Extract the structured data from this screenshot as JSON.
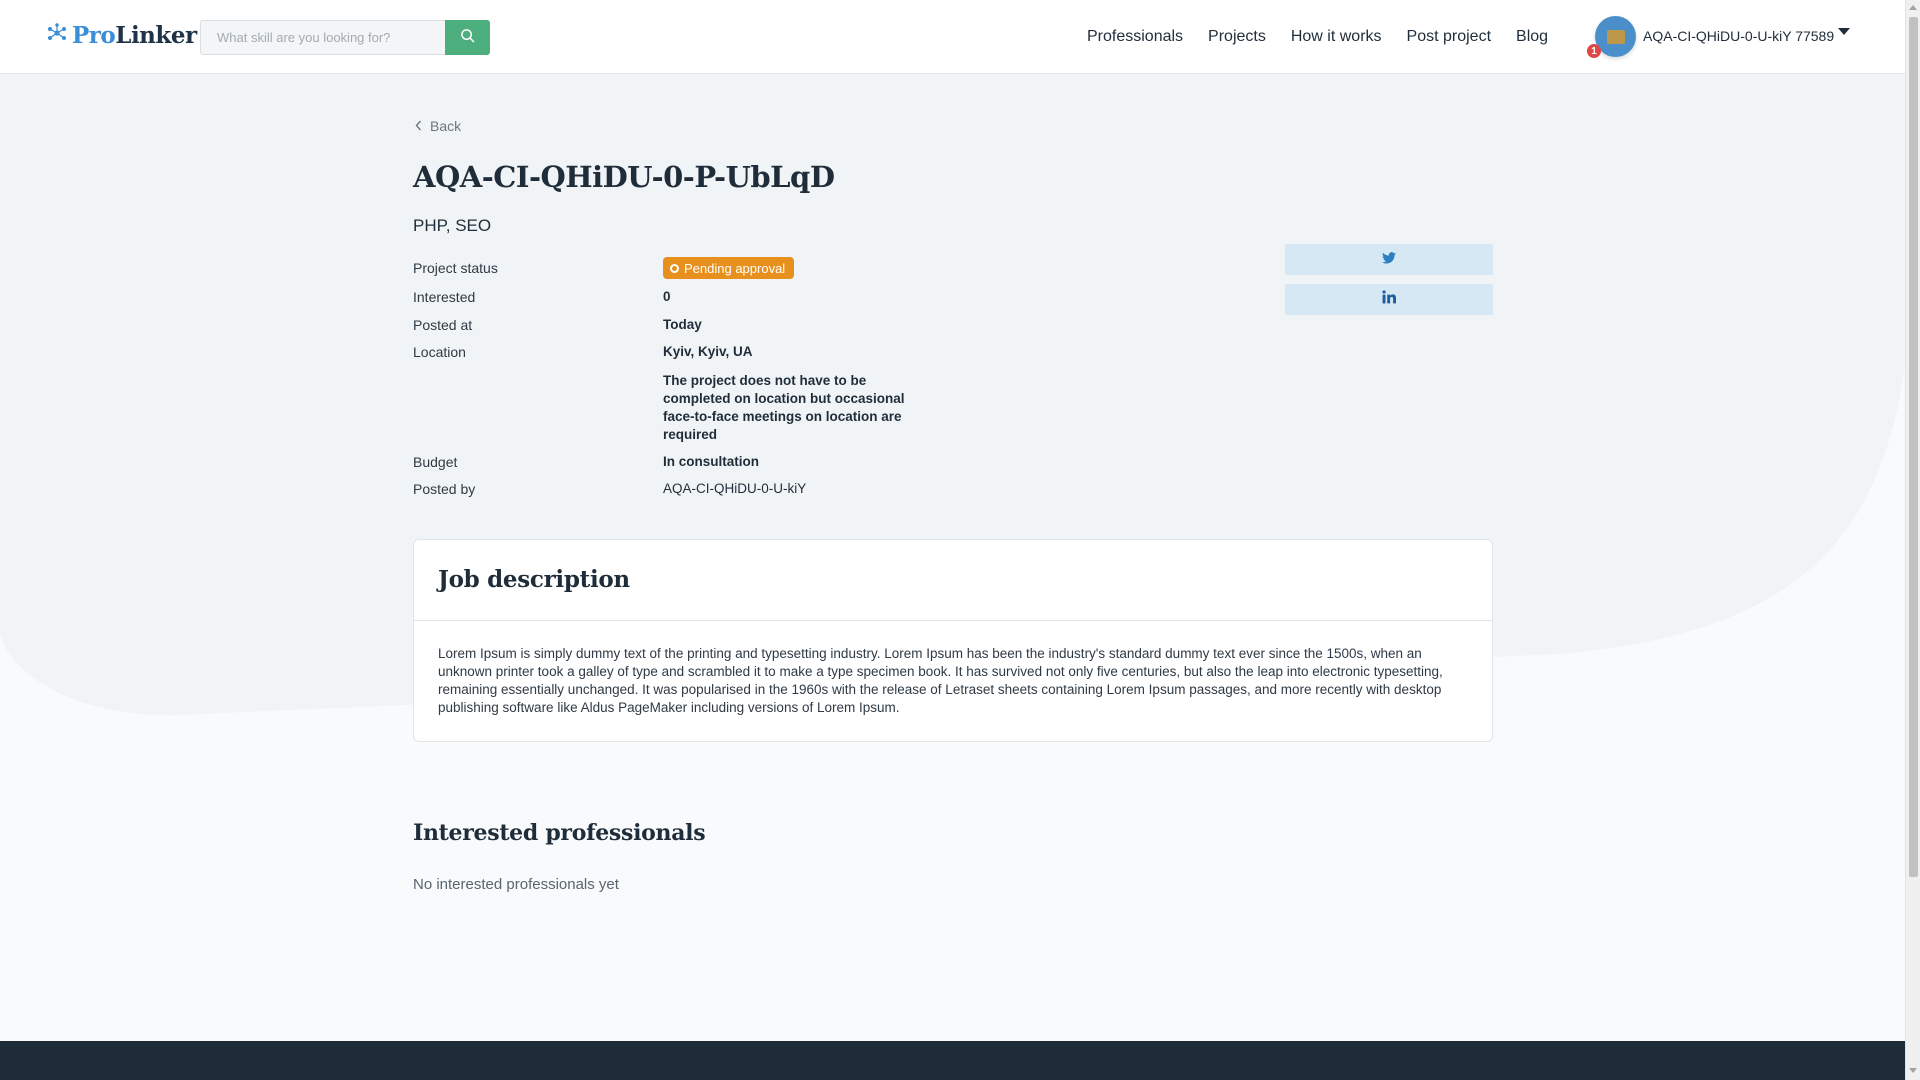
{
  "header": {
    "logo_part1": "Pro",
    "logo_part2": "Linker",
    "search_placeholder": "What skill are you looking for?",
    "nav": [
      "Professionals",
      "Projects",
      "How it works",
      "Post project",
      "Blog"
    ],
    "notification_count": "1",
    "user_name": "AQA-CI-QHiDU-0-U-kiY 77589"
  },
  "project": {
    "back_label": "Back",
    "title": "AQA-CI-QHiDU-0-P-UbLqD",
    "skills": "PHP, SEO",
    "rows": {
      "status_label": "Project status",
      "status_value": "Pending approval",
      "interested_label": "Interested",
      "interested_value": "0",
      "posted_at_label": "Posted at",
      "posted_at_value": "Today",
      "location_label": "Location",
      "location_value": "Kyiv, Kyiv, UA",
      "location_note": "The project does not have to be completed on location but occasional face-to-face meetings on location are required",
      "budget_label": "Budget",
      "budget_value": "In consultation",
      "posted_by_label": "Posted by",
      "posted_by_value": "AQA-CI-QHiDU-0-U-kiY"
    }
  },
  "description": {
    "title": "Job description",
    "text": "Lorem Ipsum is simply dummy text of the printing and typesetting industry. Lorem Ipsum has been the industry's standard dummy text ever since the 1500s, when an unknown printer took a galley of type and scrambled it to make a type specimen book. It has survived not only five centuries, but also the leap into electronic typesetting, remaining essentially unchanged. It was popularised in the 1960s with the release of Letraset sheets containing Lorem Ipsum passages, and more recently with desktop publishing software like Aldus PageMaker including versions of Lorem Ipsum."
  },
  "interested": {
    "title": "Interested professionals",
    "empty_text": "No interested professionals yet"
  },
  "colors": {
    "accent_green": "#4caf7d",
    "status_orange": "#e8901e",
    "brand_blue": "#3a8ed8",
    "footer_dark": "#1e2b38"
  },
  "icons": [
    "logo-icon",
    "search-icon",
    "chevron-left-icon",
    "twitter-icon",
    "linkedin-icon",
    "caret-down-icon"
  ]
}
